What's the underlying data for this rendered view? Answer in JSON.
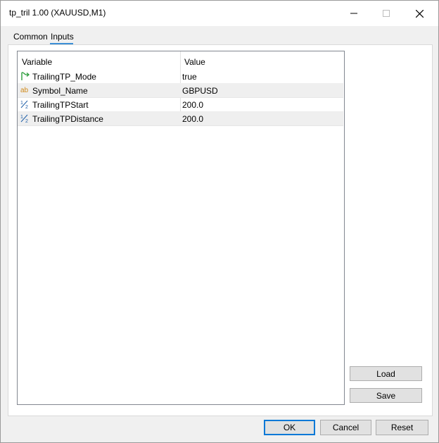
{
  "window": {
    "title": "tp_tril 1.00 (XAUUSD,M1)"
  },
  "tabs": [
    {
      "label": "Common",
      "active": false
    },
    {
      "label": "Inputs",
      "active": true
    }
  ],
  "grid": {
    "headers": {
      "variable": "Variable",
      "value": "Value"
    },
    "rows": [
      {
        "icon": "boolean-flag-icon",
        "name": "TrailingTP_Mode",
        "value": "true"
      },
      {
        "icon": "string-ab-icon",
        "name": "Symbol_Name",
        "value": "GBPUSD"
      },
      {
        "icon": "double-half-icon",
        "name": "TrailingTPStart",
        "value": "200.0"
      },
      {
        "icon": "double-half-icon",
        "name": "TrailingTPDistance",
        "value": "200.0"
      }
    ]
  },
  "side_buttons": {
    "load": "Load",
    "save": "Save"
  },
  "footer_buttons": {
    "ok": "OK",
    "cancel": "Cancel",
    "reset": "Reset"
  },
  "colors": {
    "accent": "#0078d7",
    "tab_underline": "#3c8fd6",
    "bool_icon": "#2e9e3e",
    "string_icon": "#d08a1a",
    "double_icon": "#1f5fa8"
  }
}
